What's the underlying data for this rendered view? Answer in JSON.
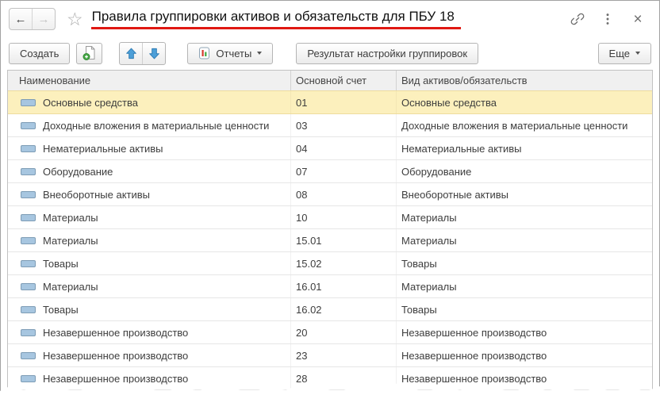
{
  "window": {
    "title": "Правила группировки активов и обязательств для ПБУ 18",
    "underline_color": "#e01812"
  },
  "icons": {
    "back": "←",
    "forward": "→",
    "star": "☆",
    "close": "×"
  },
  "toolbar": {
    "create_label": "Создать",
    "reports_label": "Отчеты",
    "result_label": "Результат настройки группировок",
    "more_label": "Еще"
  },
  "table": {
    "columns": [
      "Наименование",
      "Основной счет",
      "Вид активов/обязательств"
    ],
    "selected_row_color": "#fcf0bd",
    "rows": [
      {
        "name": "Основные средства",
        "account": "01",
        "kind": "Основные средства",
        "selected": true
      },
      {
        "name": "Доходные вложения в материальные ценности",
        "account": "03",
        "kind": "Доходные вложения в материальные ценности",
        "selected": false
      },
      {
        "name": "Нематериальные активы",
        "account": "04",
        "kind": "Нематериальные активы",
        "selected": false
      },
      {
        "name": "Оборудование",
        "account": "07",
        "kind": "Оборудование",
        "selected": false
      },
      {
        "name": "Внеоборотные активы",
        "account": "08",
        "kind": "Внеоборотные активы",
        "selected": false
      },
      {
        "name": "Материалы",
        "account": "10",
        "kind": "Материалы",
        "selected": false
      },
      {
        "name": "Материалы",
        "account": "15.01",
        "kind": "Материалы",
        "selected": false
      },
      {
        "name": "Товары",
        "account": "15.02",
        "kind": "Товары",
        "selected": false
      },
      {
        "name": "Материалы",
        "account": "16.01",
        "kind": "Материалы",
        "selected": false
      },
      {
        "name": "Товары",
        "account": "16.02",
        "kind": "Товары",
        "selected": false
      },
      {
        "name": "Незавершенное производство",
        "account": "20",
        "kind": "Незавершенное производство",
        "selected": false
      },
      {
        "name": "Незавершенное производство",
        "account": "23",
        "kind": "Незавершенное производство",
        "selected": false
      },
      {
        "name": "Незавершенное производство",
        "account": "28",
        "kind": "Незавершенное производство",
        "selected": false
      }
    ]
  }
}
